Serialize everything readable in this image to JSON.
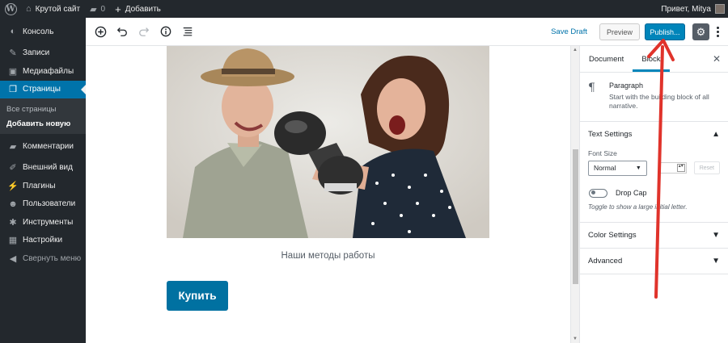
{
  "adminbar": {
    "site_name": "Крутой сайт",
    "comments_count": "0",
    "add_new": "Добавить",
    "greeting": "Привет, Mitya"
  },
  "sidebar": {
    "items": [
      {
        "label": "Консоль",
        "icon": "dashboard-icon"
      },
      {
        "label": "Записи",
        "icon": "pin-icon"
      },
      {
        "label": "Медиафайлы",
        "icon": "media-icon"
      },
      {
        "label": "Страницы",
        "icon": "pages-icon"
      },
      {
        "label": "Комментарии",
        "icon": "comments-icon"
      },
      {
        "label": "Внешний вид",
        "icon": "brush-icon"
      },
      {
        "label": "Плагины",
        "icon": "plugin-icon"
      },
      {
        "label": "Пользователи",
        "icon": "users-icon"
      },
      {
        "label": "Инструменты",
        "icon": "wrench-icon"
      },
      {
        "label": "Настройки",
        "icon": "settings-icon"
      }
    ],
    "submenu": [
      "Все страницы",
      "Добавить новую"
    ],
    "collapse_label": "Свернуть меню"
  },
  "toolbar": {
    "save_draft": "Save Draft",
    "preview": "Preview",
    "publish": "Publish..."
  },
  "content": {
    "caption": "Наши методы работы",
    "button_label": "Купить"
  },
  "panel": {
    "tab_document": "Document",
    "tab_block": "Block",
    "block_title": "Paragraph",
    "block_description": "Start with the building block of all narrative.",
    "text_settings": "Text Settings",
    "font_size_label": "Font Size",
    "font_size_value": "Normal",
    "reset_label": "Reset",
    "drop_cap_label": "Drop Cap",
    "drop_cap_help": "Toggle to show a large initial letter.",
    "color_settings": "Color Settings",
    "advanced": "Advanced"
  },
  "colors": {
    "admin_dark": "#23282d",
    "accent_blue": "#0073aa",
    "publish_blue": "#0085ba",
    "annotation_red": "#e0332b"
  }
}
